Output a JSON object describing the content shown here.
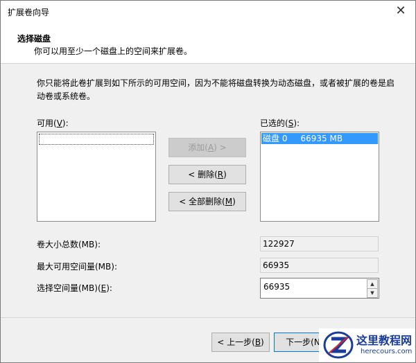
{
  "window": {
    "title": "扩展卷向导"
  },
  "header": {
    "title": "选择磁盘",
    "subtitle": "你可以用至少一个磁盘上的空间来扩展卷。"
  },
  "description": "你只能将此卷扩展到如下所示的可用空间，因为不能将磁盘转换为动态磁盘，或者被扩展的卷是启动卷或系统卷。",
  "available": {
    "label": "可用(",
    "hotkey": "V",
    "label_end": "):",
    "items": []
  },
  "selected": {
    "label": "已选的(",
    "hotkey": "S",
    "label_end": "):",
    "items": [
      "磁盘 0     66935 MB"
    ]
  },
  "buttons": {
    "add": {
      "label": "添加(",
      "hotkey": "A",
      "label_end": ") >"
    },
    "remove": {
      "label": "< 删除(",
      "hotkey": "R",
      "label_end": ")"
    },
    "remove_all": {
      "label": "< 全部删除(",
      "hotkey": "M",
      "label_end": ")"
    },
    "back": {
      "label": "< 上一步(",
      "hotkey": "B",
      "label_end": ")"
    },
    "next": {
      "label": "下一步(N"
    }
  },
  "fields": {
    "total": {
      "label": "卷大小总数(MB):",
      "value": "122927"
    },
    "max": {
      "label": "最大可用空间量(MB):",
      "value": "66935"
    },
    "select": {
      "label": "选择空间量(MB)(",
      "hotkey": "E",
      "label_end": "):",
      "value": "66935"
    }
  },
  "watermark": {
    "name": "这里教程网",
    "url": "herecours.com"
  },
  "colors": {
    "selection": "#3399ff",
    "watermark": "#1a3c9a"
  }
}
